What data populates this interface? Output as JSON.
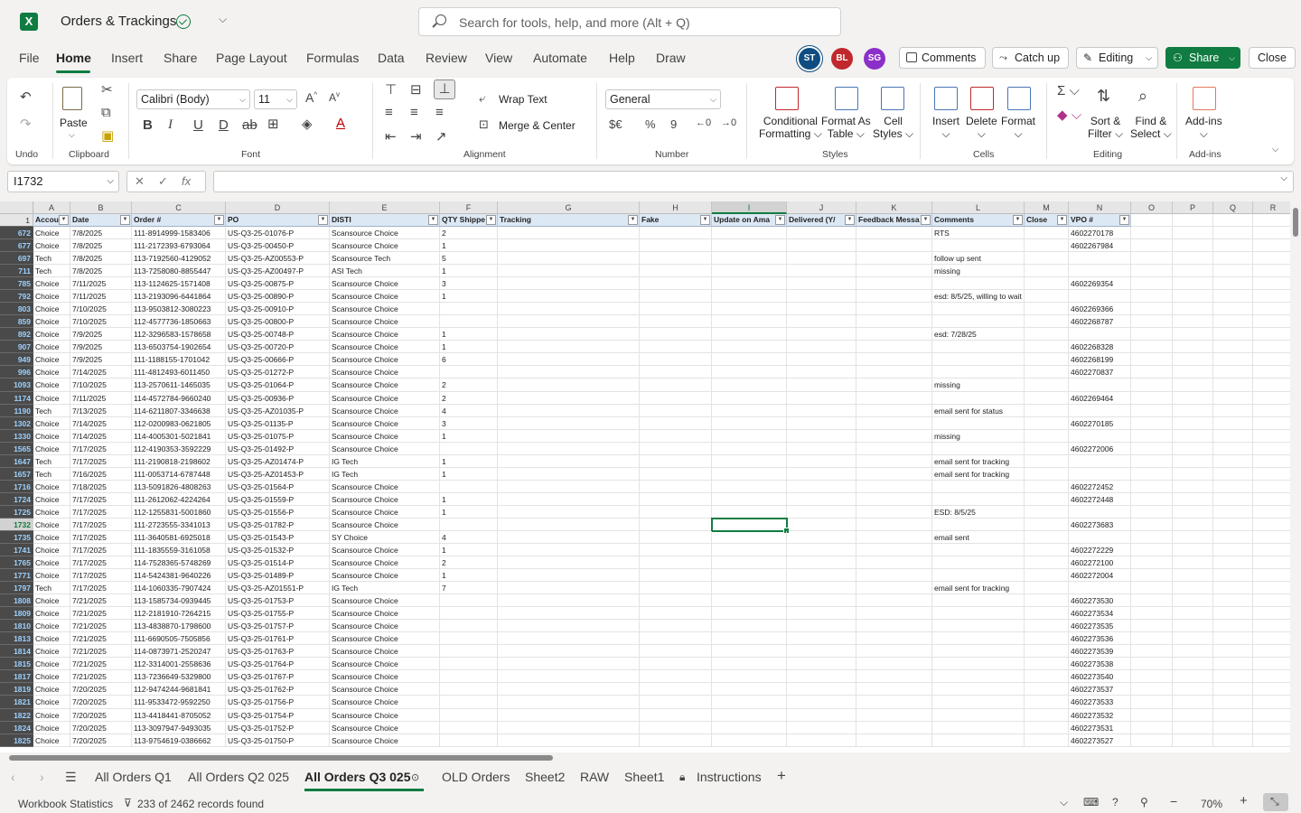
{
  "titlebar": {
    "app_logo": "X",
    "title": "Orders & Trackings",
    "search_placeholder": "Search for tools, help, and more (Alt + Q)"
  },
  "menu": {
    "tabs": [
      "File",
      "Home",
      "Insert",
      "Share",
      "Page Layout",
      "Formulas",
      "Data",
      "Review",
      "View",
      "Automate",
      "Help",
      "Draw"
    ],
    "active": "Home"
  },
  "avatars": [
    {
      "initials": "ST",
      "color": "#0f4c81"
    },
    {
      "initials": "BL",
      "color": "#c0282c"
    },
    {
      "initials": "SG",
      "color": "#8b2fc9"
    }
  ],
  "actions": {
    "comments": "Comments",
    "catchup": "Catch up",
    "editing": "Editing",
    "share": "Share",
    "close": "Close"
  },
  "ribbon": {
    "undo_label": "Undo",
    "paste_label": "Paste",
    "clipboard_label": "Clipboard",
    "font_name": "Calibri (Body)",
    "font_size": "11",
    "font_label": "Font",
    "wrap_text": "Wrap Text",
    "merge_center": "Merge & Center",
    "alignment_label": "Alignment",
    "number_format": "General",
    "number_label": "Number",
    "conditional": "Conditional",
    "formatting": "Formatting",
    "format_as": "Format As",
    "table": "Table",
    "cell": "Cell",
    "styles": "Styles",
    "styles_label": "Styles",
    "insert": "Insert",
    "delete": "Delete",
    "format": "Format",
    "cells_label": "Cells",
    "sort": "Sort &",
    "filter": "Filter",
    "find": "Find &",
    "select": "Select",
    "editing_label": "Editing",
    "addins": "Add-ins",
    "addins_label": "Add-ins"
  },
  "formula_bar": {
    "name_box": "I1732",
    "formula": ""
  },
  "columns": [
    "A",
    "B",
    "C",
    "D",
    "E",
    "F",
    "G",
    "H",
    "I",
    "J",
    "K",
    "L",
    "M",
    "N",
    "O",
    "P",
    "Q",
    "R"
  ],
  "selected_column": "I",
  "header_row_number": "1",
  "headers": [
    "Accou",
    "Date",
    "Order #",
    "PO",
    "DISTI",
    "QTY Shippe",
    "Tracking",
    "Fake",
    "Update on Ama",
    "Delivered (Y/",
    "Feedback Messa",
    "Comments",
    "Close",
    "VPO #"
  ],
  "rows": [
    {
      "n": "672",
      "a": "Choice",
      "b": "7/8/2025",
      "c": "111-8914999-1583406",
      "d": "US-Q3-25-01076-P",
      "e": "Scansource Choice",
      "f": "2",
      "l": "RTS",
      "nn": "4602270178"
    },
    {
      "n": "677",
      "a": "Choice",
      "b": "7/8/2025",
      "c": "111-2172393-6793064",
      "d": "US-Q3-25-00450-P",
      "e": "Scansource Choice",
      "f": "1",
      "l": "",
      "nn": "4602267984"
    },
    {
      "n": "697",
      "a": "Tech",
      "b": "7/8/2025",
      "c": "113-7192560-4129052",
      "d": "US-Q3-25-AZ00553-P",
      "e": "Scansource Tech",
      "f": "5",
      "l": "follow up sent",
      "nn": ""
    },
    {
      "n": "711",
      "a": "Tech",
      "b": "7/8/2025",
      "c": "113-7258080-8855447",
      "d": "US-Q3-25-AZ00497-P",
      "e": "ASI Tech",
      "f": "1",
      "l": "missing",
      "nn": ""
    },
    {
      "n": "785",
      "a": "Choice",
      "b": "7/11/2025",
      "c": "113-1124625-1571408",
      "d": "US-Q3-25-00875-P",
      "e": "Scansource Choice",
      "f": "3",
      "l": "",
      "nn": "4602269354"
    },
    {
      "n": "792",
      "a": "Choice",
      "b": "7/11/2025",
      "c": "113-2193096-6441864",
      "d": "US-Q3-25-00890-P",
      "e": "Scansource Choice",
      "f": "1",
      "l": "esd: 8/5/25, willing to wait",
      "nn": ""
    },
    {
      "n": "803",
      "a": "Choice",
      "b": "7/10/2025",
      "c": "113-9503812-3080223",
      "d": "US-Q3-25-00910-P",
      "e": "Scansource Choice",
      "f": "",
      "l": "",
      "nn": "4602269366"
    },
    {
      "n": "859",
      "a": "Choice",
      "b": "7/10/2025",
      "c": "112-4577736-1850663",
      "d": "US-Q3-25-00800-P",
      "e": "Scansource Choice",
      "f": "",
      "l": "",
      "nn": "4602268787"
    },
    {
      "n": "892",
      "a": "Choice",
      "b": "7/9/2025",
      "c": "112-3296583-1578658",
      "d": "US-Q3-25-00748-P",
      "e": "Scansource Choice",
      "f": "1",
      "l": "esd: 7/28/25",
      "nn": ""
    },
    {
      "n": "907",
      "a": "Choice",
      "b": "7/9/2025",
      "c": "113-6503754-1902654",
      "d": "US-Q3-25-00720-P",
      "e": "Scansource Choice",
      "f": "1",
      "l": "",
      "nn": "4602268328"
    },
    {
      "n": "949",
      "a": "Choice",
      "b": "7/9/2025",
      "c": "111-1188155-1701042",
      "d": "US-Q3-25-00666-P",
      "e": "Scansource Choice",
      "f": "6",
      "l": "",
      "nn": "4602268199"
    },
    {
      "n": "996",
      "a": "Choice",
      "b": "7/14/2025",
      "c": "111-4812493-6011450",
      "d": "US-Q3-25-01272-P",
      "e": "Scansource Choice",
      "f": "",
      "l": "",
      "nn": "4602270837"
    },
    {
      "n": "1093",
      "a": "Choice",
      "b": "7/10/2025",
      "c": "113-2570611-1465035",
      "d": "US-Q3-25-01064-P",
      "e": "Scansource Choice",
      "f": "2",
      "l": "missing",
      "nn": ""
    },
    {
      "n": "1174",
      "a": "Choice",
      "b": "7/11/2025",
      "c": "114-4572784-9660240",
      "d": "US-Q3-25-00936-P",
      "e": "Scansource Choice",
      "f": "2",
      "l": "",
      "nn": "4602269464"
    },
    {
      "n": "1190",
      "a": "Tech",
      "b": "7/13/2025",
      "c": "114-6211807-3346638",
      "d": "US-Q3-25-AZ01035-P",
      "e": "Scansource Choice",
      "f": "4",
      "l": "email sent for status",
      "nn": ""
    },
    {
      "n": "1302",
      "a": "Choice",
      "b": "7/14/2025",
      "c": "112-0200983-0621805",
      "d": "US-Q3-25-01135-P",
      "e": "Scansource Choice",
      "f": "3",
      "l": "",
      "nn": "4602270185"
    },
    {
      "n": "1330",
      "a": "Choice",
      "b": "7/14/2025",
      "c": "114-4005301-5021841",
      "d": "US-Q3-25-01075-P",
      "e": "Scansource Choice",
      "f": "1",
      "l": "missing",
      "nn": ""
    },
    {
      "n": "1565",
      "a": "Choice",
      "b": "7/17/2025",
      "c": "112-4190353-3592229",
      "d": "US-Q3-25-01492-P",
      "e": "Scansource Choice",
      "f": "",
      "l": "",
      "nn": "4602272006"
    },
    {
      "n": "1647",
      "a": "Tech",
      "b": "7/17/2025",
      "c": "111-2190818-2198602",
      "d": "US-Q3-25-AZ01474-P",
      "e": "IG Tech",
      "f": "1",
      "l": "email sent for tracking",
      "nn": ""
    },
    {
      "n": "1657",
      "a": "Tech",
      "b": "7/16/2025",
      "c": "111-0053714-6787448",
      "d": "US-Q3-25-AZ01453-P",
      "e": "IG Tech",
      "f": "1",
      "l": "email sent for tracking",
      "nn": ""
    },
    {
      "n": "1716",
      "a": "Choice",
      "b": "7/18/2025",
      "c": "113-5091826-4808263",
      "d": "US-Q3-25-01564-P",
      "e": "Scansource Choice",
      "f": "",
      "l": "",
      "nn": "4602272452"
    },
    {
      "n": "1724",
      "a": "Choice",
      "b": "7/17/2025",
      "c": "111-2612062-4224264",
      "d": "US-Q3-25-01559-P",
      "e": "Scansource Choice",
      "f": "1",
      "l": "",
      "nn": "4602272448"
    },
    {
      "n": "1725",
      "a": "Choice",
      "b": "7/17/2025",
      "c": "112-1255831-5001860",
      "d": "US-Q3-25-01556-P",
      "e": "Scansource Choice",
      "f": "1",
      "l": "ESD:  8/5/25",
      "nn": ""
    },
    {
      "n": "1732",
      "a": "Choice",
      "b": "7/17/2025",
      "c": "111-2723555-3341013",
      "d": "US-Q3-25-01782-P",
      "e": "Scansource Choice",
      "f": "",
      "l": "",
      "nn": "4602273683"
    },
    {
      "n": "1735",
      "a": "Choice",
      "b": "7/17/2025",
      "c": "111-3640581-6925018",
      "d": "US-Q3-25-01543-P",
      "e": "SY Choice",
      "f": "4",
      "l": "email sent",
      "nn": ""
    },
    {
      "n": "1741",
      "a": "Choice",
      "b": "7/17/2025",
      "c": "111-1835559-3161058",
      "d": "US-Q3-25-01532-P",
      "e": "Scansource Choice",
      "f": "1",
      "l": "",
      "nn": "4602272229"
    },
    {
      "n": "1765",
      "a": "Choice",
      "b": "7/17/2025",
      "c": "114-7528365-5748269",
      "d": "US-Q3-25-01514-P",
      "e": "Scansource Choice",
      "f": "2",
      "l": "",
      "nn": "4602272100"
    },
    {
      "n": "1771",
      "a": "Choice",
      "b": "7/17/2025",
      "c": "114-5424381-9640226",
      "d": "US-Q3-25-01489-P",
      "e": "Scansource Choice",
      "f": "1",
      "l": "",
      "nn": "4602272004"
    },
    {
      "n": "1797",
      "a": "Tech",
      "b": "7/17/2025",
      "c": "114-1060335-7907424",
      "d": "US-Q3-25-AZ01551-P",
      "e": "IG Tech",
      "f": "7",
      "l": "email sent for tracking",
      "nn": ""
    },
    {
      "n": "1808",
      "a": "Choice",
      "b": "7/21/2025",
      "c": "113-1585734-0939445",
      "d": "US-Q3-25-01753-P",
      "e": "Scansource Choice",
      "f": "",
      "l": "",
      "nn": "4602273530"
    },
    {
      "n": "1809",
      "a": "Choice",
      "b": "7/21/2025",
      "c": "112-2181910-7264215",
      "d": "US-Q3-25-01755-P",
      "e": "Scansource Choice",
      "f": "",
      "l": "",
      "nn": "4602273534"
    },
    {
      "n": "1810",
      "a": "Choice",
      "b": "7/21/2025",
      "c": "113-4838870-1798600",
      "d": "US-Q3-25-01757-P",
      "e": "Scansource Choice",
      "f": "",
      "l": "",
      "nn": "4602273535"
    },
    {
      "n": "1813",
      "a": "Choice",
      "b": "7/21/2025",
      "c": "111-6690505-7505856",
      "d": "US-Q3-25-01761-P",
      "e": "Scansource Choice",
      "f": "",
      "l": "",
      "nn": "4602273536"
    },
    {
      "n": "1814",
      "a": "Choice",
      "b": "7/21/2025",
      "c": "114-0873971-2520247",
      "d": "US-Q3-25-01763-P",
      "e": "Scansource Choice",
      "f": "",
      "l": "",
      "nn": "4602273539"
    },
    {
      "n": "1815",
      "a": "Choice",
      "b": "7/21/2025",
      "c": "112-3314001-2558636",
      "d": "US-Q3-25-01764-P",
      "e": "Scansource Choice",
      "f": "",
      "l": "",
      "nn": "4602273538"
    },
    {
      "n": "1817",
      "a": "Choice",
      "b": "7/21/2025",
      "c": "113-7236649-5329800",
      "d": "US-Q3-25-01767-P",
      "e": "Scansource Choice",
      "f": "",
      "l": "",
      "nn": "4602273540"
    },
    {
      "n": "1819",
      "a": "Choice",
      "b": "7/20/2025",
      "c": "112-9474244-9681841",
      "d": "US-Q3-25-01762-P",
      "e": "Scansource Choice",
      "f": "",
      "l": "",
      "nn": "4602273537"
    },
    {
      "n": "1821",
      "a": "Choice",
      "b": "7/20/2025",
      "c": "111-9533472-9592250",
      "d": "US-Q3-25-01756-P",
      "e": "Scansource Choice",
      "f": "",
      "l": "",
      "nn": "4602273533"
    },
    {
      "n": "1822",
      "a": "Choice",
      "b": "7/20/2025",
      "c": "113-4418441-8705052",
      "d": "US-Q3-25-01754-P",
      "e": "Scansource Choice",
      "f": "",
      "l": "",
      "nn": "4602273532"
    },
    {
      "n": "1824",
      "a": "Choice",
      "b": "7/20/2025",
      "c": "113-3097947-9493035",
      "d": "US-Q3-25-01752-P",
      "e": "Scansource Choice",
      "f": "",
      "l": "",
      "nn": "4602273531"
    },
    {
      "n": "1825",
      "a": "Choice",
      "b": "7/20/2025",
      "c": "113-9754619-0386662",
      "d": "US-Q3-25-01750-P",
      "e": "Scansource Choice",
      "f": "",
      "l": "",
      "nn": "4602273527"
    }
  ],
  "selected_row": "1732",
  "sheets": {
    "tabs": [
      "All Orders Q1",
      "All Orders Q2 025",
      "All Orders Q3 025",
      "OLD Orders",
      "Sheet2",
      "RAW",
      "Sheet1",
      "Instructions"
    ],
    "active": "All Orders Q3 025"
  },
  "status": {
    "workbook_stats": "Workbook Statistics",
    "records": "233 of 2462 records found",
    "zoom": "70%"
  },
  "colors": {
    "accent": "#107c41",
    "header_fill": "#dde8f5",
    "rownum_bg": "#4a4a4a"
  }
}
